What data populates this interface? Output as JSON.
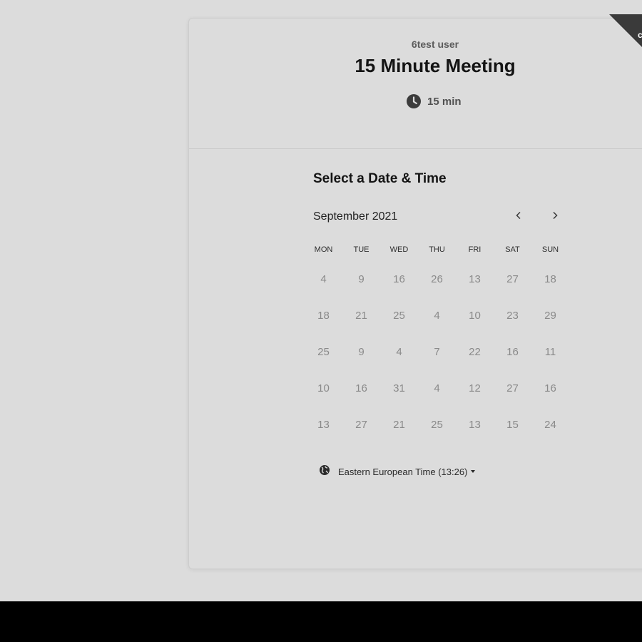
{
  "event": {
    "host_name": "6test user",
    "title": "15 Minute Meeting",
    "duration": "15 min",
    "duration_icon": "clock-icon"
  },
  "corner_badge": {
    "glyph": "c"
  },
  "scheduler": {
    "section_title": "Select a Date & Time",
    "month_label": "September 2021",
    "prev_icon": "chevron-left-icon",
    "next_icon": "chevron-right-icon",
    "weekdays": [
      "MON",
      "TUE",
      "WED",
      "THU",
      "FRI",
      "SAT",
      "SUN"
    ],
    "days": [
      [
        "4",
        "9",
        "16",
        "26",
        "13",
        "27",
        "18"
      ],
      [
        "18",
        "21",
        "25",
        "4",
        "10",
        "23",
        "29"
      ],
      [
        "25",
        "9",
        "4",
        "7",
        "22",
        "16",
        "11"
      ],
      [
        "10",
        "16",
        "31",
        "4",
        "12",
        "27",
        "16"
      ],
      [
        "13",
        "27",
        "21",
        "25",
        "13",
        "15",
        "24"
      ]
    ],
    "timezone": {
      "label": "Eastern European Time (13:26)",
      "icon": "globe-icon"
    }
  },
  "colors": {
    "page_background": "#dcdcdc",
    "bottom_bar": "#000000",
    "badge": "#3a3a3a"
  }
}
